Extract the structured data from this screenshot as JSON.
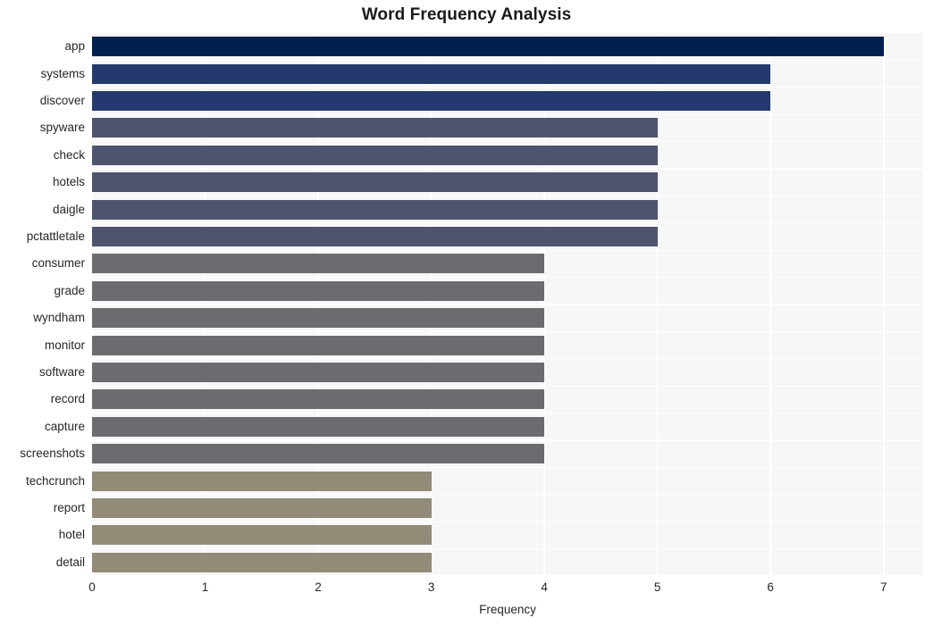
{
  "chart_data": {
    "type": "bar",
    "orientation": "horizontal",
    "title": "Word Frequency Analysis",
    "xlabel": "Frequency",
    "ylabel": "",
    "xlim": [
      0,
      7.35
    ],
    "xticks": [
      "0",
      "1",
      "2",
      "3",
      "4",
      "5",
      "6",
      "7"
    ],
    "xtick_values": [
      0,
      1,
      2,
      3,
      4,
      5,
      6,
      7
    ],
    "grid": "vertical-and-horizontal-white-on-gray",
    "legend": "none",
    "categories": [
      "app",
      "systems",
      "discover",
      "spyware",
      "check",
      "hotels",
      "daigle",
      "pctattletale",
      "consumer",
      "grade",
      "wyndham",
      "monitor",
      "software",
      "record",
      "capture",
      "screenshots",
      "techcrunch",
      "report",
      "hotel",
      "detail"
    ],
    "values": [
      7,
      6,
      6,
      5,
      5,
      5,
      5,
      5,
      4,
      4,
      4,
      4,
      4,
      4,
      4,
      4,
      3,
      3,
      3,
      3
    ],
    "bar_colors": [
      "#002050",
      "#24396e",
      "#24396e",
      "#4e5470",
      "#4e5470",
      "#4e5470",
      "#4e5470",
      "#4e5470",
      "#6b6b70",
      "#6b6b70",
      "#6b6b70",
      "#6b6b70",
      "#6b6b70",
      "#6b6b70",
      "#6b6b70",
      "#6b6b70",
      "#918b78",
      "#918b78",
      "#918b78",
      "#918b78"
    ],
    "plot_background": "#f7f7f7",
    "gridline_color": "#ffffff",
    "figure_background": "#ffffff",
    "text_color": "#262626"
  }
}
